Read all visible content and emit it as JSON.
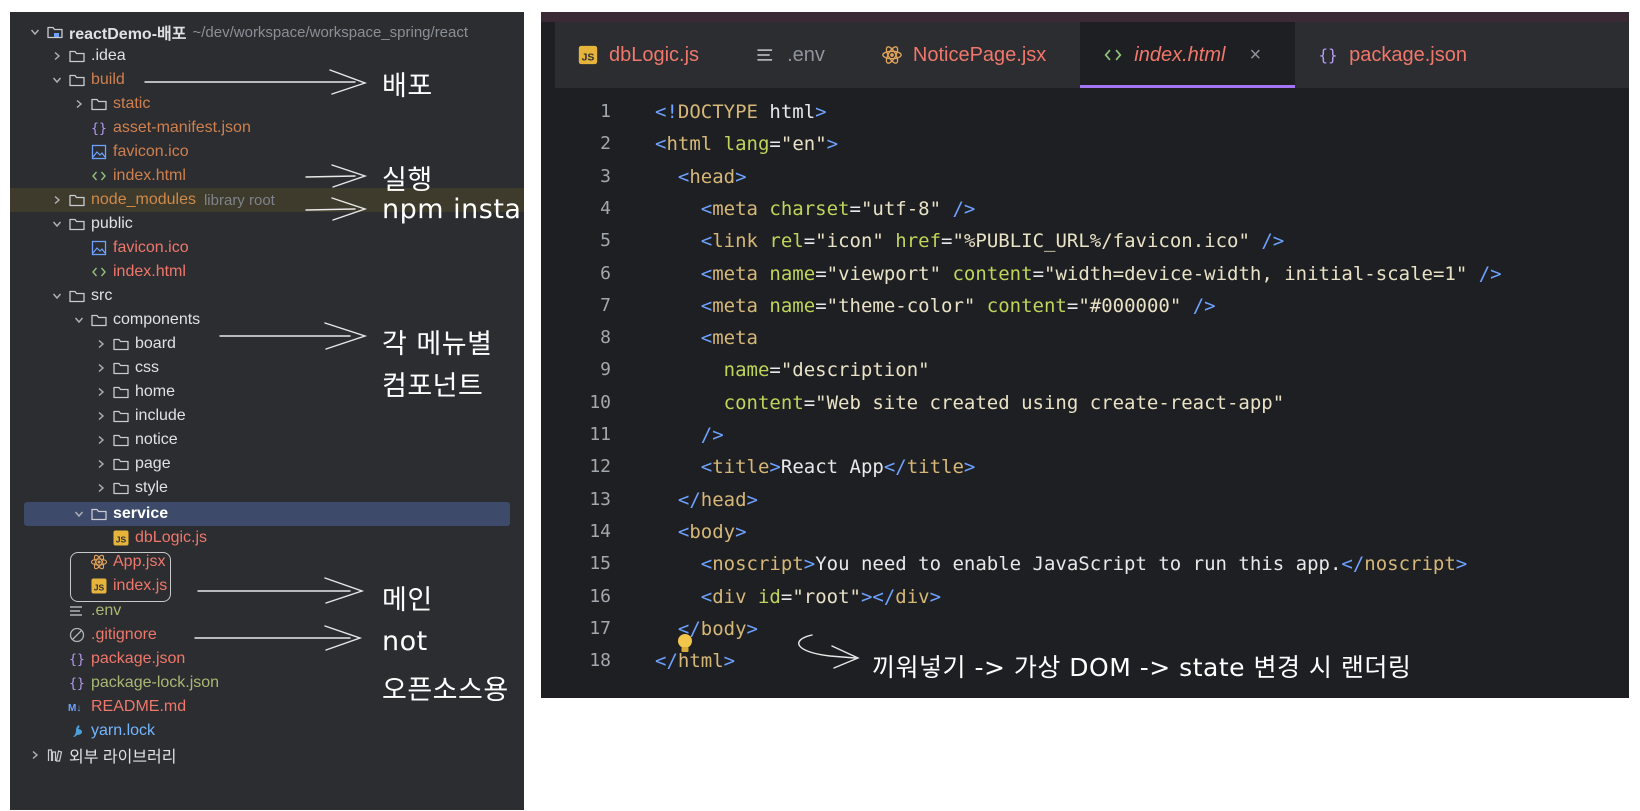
{
  "project_tree": {
    "root": {
      "name": "reactDemo-배포",
      "path": "~/dev/workspace/workspace_spring/react"
    },
    "items": [
      {
        "label": "reactDemo-배포",
        "hint": "~/dev/workspace/workspace_spring/react",
        "icon": "folder-module-icon",
        "expanded": true,
        "color": "default"
      },
      {
        "label": ".idea",
        "icon": "folder-icon",
        "expanded": false,
        "color": "default"
      },
      {
        "label": "build",
        "icon": "folder-icon",
        "expanded": true,
        "color": "excluded"
      },
      {
        "label": "static",
        "icon": "folder-icon",
        "expanded": false,
        "color": "excluded"
      },
      {
        "label": "asset-manifest.json",
        "icon": "json-icon",
        "color": "excluded"
      },
      {
        "label": "favicon.ico",
        "icon": "image-icon",
        "color": "excluded"
      },
      {
        "label": "index.html",
        "icon": "html-icon",
        "color": "excluded"
      },
      {
        "label": "node_modules",
        "hint": "library root",
        "icon": "folder-icon",
        "expanded": false,
        "color": "lib"
      },
      {
        "label": "public",
        "icon": "folder-icon",
        "expanded": true,
        "color": "default"
      },
      {
        "label": "favicon.ico",
        "icon": "image-icon",
        "color": "red"
      },
      {
        "label": "index.html",
        "icon": "html-icon",
        "color": "red"
      },
      {
        "label": "src",
        "icon": "folder-icon",
        "expanded": true,
        "color": "default"
      },
      {
        "label": "components",
        "icon": "folder-icon",
        "expanded": true,
        "color": "default"
      },
      {
        "label": "board",
        "icon": "folder-icon",
        "expanded": false,
        "color": "default"
      },
      {
        "label": "css",
        "icon": "folder-icon",
        "expanded": false,
        "color": "default"
      },
      {
        "label": "home",
        "icon": "folder-icon",
        "expanded": false,
        "color": "default"
      },
      {
        "label": "include",
        "icon": "folder-icon",
        "expanded": false,
        "color": "default"
      },
      {
        "label": "notice",
        "icon": "folder-icon",
        "expanded": false,
        "color": "default"
      },
      {
        "label": "page",
        "icon": "folder-icon",
        "expanded": false,
        "color": "default"
      },
      {
        "label": "style",
        "icon": "folder-icon",
        "expanded": false,
        "color": "default"
      },
      {
        "label": "service",
        "icon": "folder-icon",
        "expanded": true,
        "color": "default",
        "selected": true
      },
      {
        "label": "dbLogic.js",
        "icon": "js-icon",
        "color": "red"
      },
      {
        "label": "App.jsx",
        "icon": "react-icon",
        "color": "red"
      },
      {
        "label": "index.js",
        "icon": "js-icon",
        "color": "red"
      },
      {
        "label": ".env",
        "icon": "env-lines-icon",
        "color": "green"
      },
      {
        "label": ".gitignore",
        "icon": "ignore-icon",
        "color": "red"
      },
      {
        "label": "package.json",
        "icon": "json-icon",
        "color": "red"
      },
      {
        "label": "package-lock.json",
        "icon": "json-icon",
        "color": "green"
      },
      {
        "label": "README.md",
        "icon": "markdown-icon",
        "color": "red"
      },
      {
        "label": "yarn.lock",
        "icon": "yarn-icon",
        "color": "blue"
      },
      {
        "label": "외부 라이브러리",
        "icon": "library-icon",
        "expanded": false,
        "color": "default"
      }
    ]
  },
  "annotations": {
    "build": "배포",
    "index_html": "실행",
    "node_modules": "npm install",
    "components_line1": "각 메뉴별",
    "components_line2": "컴포넌트",
    "main": "메인",
    "env_line1": "not",
    "env_line2": "오픈소스용",
    "root_div": "끼워넣기 -> 가상 DOM -> state 변경 시 랜더링"
  },
  "editor": {
    "tabs": [
      {
        "label": "dbLogic.js",
        "icon": "js-icon",
        "style": "red",
        "active": false
      },
      {
        "label": ".env",
        "icon": "env-lines-icon",
        "style": "gray",
        "active": false
      },
      {
        "label": "NoticePage.jsx",
        "icon": "react-icon",
        "style": "red",
        "active": false
      },
      {
        "label": "index.html",
        "icon": "html-icon",
        "style": "red",
        "active": true,
        "close": "×"
      },
      {
        "label": "package.json",
        "icon": "json-icon",
        "style": "red",
        "active": false
      }
    ],
    "line_numbers": [
      "1",
      "2",
      "3",
      "4",
      "5",
      "6",
      "7",
      "8",
      "9",
      "10",
      "11",
      "12",
      "13",
      "14",
      "15",
      "16",
      "17",
      "18"
    ],
    "code_lines": [
      [
        [
          "br",
          "<!"
        ],
        [
          "kw",
          "DOCTYPE "
        ],
        [
          "txt",
          "html"
        ],
        [
          "br",
          ">"
        ]
      ],
      [
        [
          "br",
          "<"
        ],
        [
          "tag",
          "html "
        ],
        [
          "attr",
          "lang"
        ],
        [
          "txt",
          "="
        ],
        [
          "val",
          "\"en\""
        ],
        [
          "br",
          ">"
        ]
      ],
      [
        [
          "txt",
          "  "
        ],
        [
          "br",
          "<"
        ],
        [
          "tag",
          "head"
        ],
        [
          "br",
          ">"
        ]
      ],
      [
        [
          "txt",
          "    "
        ],
        [
          "br",
          "<"
        ],
        [
          "tag",
          "meta "
        ],
        [
          "attr",
          "charset"
        ],
        [
          "txt",
          "="
        ],
        [
          "val",
          "\"utf-8\""
        ],
        [
          "br",
          " />"
        ]
      ],
      [
        [
          "txt",
          "    "
        ],
        [
          "br",
          "<"
        ],
        [
          "tag",
          "link "
        ],
        [
          "attr",
          "rel"
        ],
        [
          "txt",
          "="
        ],
        [
          "val",
          "\"icon\" "
        ],
        [
          "attr",
          "href"
        ],
        [
          "txt",
          "="
        ],
        [
          "val",
          "\"%PUBLIC_URL%/favicon.ico\""
        ],
        [
          "br",
          " />"
        ]
      ],
      [
        [
          "txt",
          "    "
        ],
        [
          "br",
          "<"
        ],
        [
          "tag",
          "meta "
        ],
        [
          "attr",
          "name"
        ],
        [
          "txt",
          "="
        ],
        [
          "val",
          "\"viewport\" "
        ],
        [
          "attr",
          "content"
        ],
        [
          "txt",
          "="
        ],
        [
          "val",
          "\"width=device-width, initial-scale=1\""
        ],
        [
          "br",
          " />"
        ]
      ],
      [
        [
          "txt",
          "    "
        ],
        [
          "br",
          "<"
        ],
        [
          "tag",
          "meta "
        ],
        [
          "attr",
          "name"
        ],
        [
          "txt",
          "="
        ],
        [
          "val",
          "\"theme-color\" "
        ],
        [
          "attr",
          "content"
        ],
        [
          "txt",
          "="
        ],
        [
          "val",
          "\"#000000\""
        ],
        [
          "br",
          " />"
        ]
      ],
      [
        [
          "txt",
          "    "
        ],
        [
          "br",
          "<"
        ],
        [
          "tag",
          "meta"
        ]
      ],
      [
        [
          "txt",
          "      "
        ],
        [
          "attr",
          "name"
        ],
        [
          "txt",
          "="
        ],
        [
          "val",
          "\"description\""
        ]
      ],
      [
        [
          "txt",
          "      "
        ],
        [
          "attr",
          "content"
        ],
        [
          "txt",
          "="
        ],
        [
          "val",
          "\"Web site created using create-react-app\""
        ]
      ],
      [
        [
          "txt",
          "    "
        ],
        [
          "br",
          "/>"
        ]
      ],
      [
        [
          "txt",
          "    "
        ],
        [
          "br",
          "<"
        ],
        [
          "tag",
          "title"
        ],
        [
          "br",
          ">"
        ],
        [
          "txt",
          "React App"
        ],
        [
          "br",
          "</"
        ],
        [
          "tag",
          "title"
        ],
        [
          "br",
          ">"
        ]
      ],
      [
        [
          "txt",
          "  "
        ],
        [
          "br",
          "</"
        ],
        [
          "tag",
          "head"
        ],
        [
          "br",
          ">"
        ]
      ],
      [
        [
          "txt",
          "  "
        ],
        [
          "br",
          "<"
        ],
        [
          "tag",
          "body"
        ],
        [
          "br",
          ">"
        ]
      ],
      [
        [
          "txt",
          "    "
        ],
        [
          "br",
          "<"
        ],
        [
          "tag",
          "noscript"
        ],
        [
          "br",
          ">"
        ],
        [
          "txt",
          "You need to enable JavaScript to run this app."
        ],
        [
          "br",
          "</"
        ],
        [
          "tag",
          "noscript"
        ],
        [
          "br",
          ">"
        ]
      ],
      [
        [
          "txt",
          "    "
        ],
        [
          "br",
          "<"
        ],
        [
          "tag",
          "div "
        ],
        [
          "attr",
          "id"
        ],
        [
          "txt",
          "="
        ],
        [
          "val",
          "\"root\""
        ],
        [
          "br",
          "></"
        ],
        [
          "tag",
          "div"
        ],
        [
          "br",
          ">"
        ]
      ],
      [
        [
          "txt",
          "  "
        ],
        [
          "br",
          "</"
        ],
        [
          "tag",
          "body"
        ],
        [
          "br",
          ">"
        ]
      ],
      [
        [
          "br",
          "</"
        ],
        [
          "tag",
          "html"
        ],
        [
          "br",
          ">"
        ]
      ]
    ]
  },
  "colors": {
    "panel_bg": "#2b2d30",
    "editor_bg": "#1e1f22",
    "selection": "#3d4a6a",
    "active_tab_underline": "#a375f2",
    "red_file": "#f0776b",
    "green_file": "#a9b873",
    "excluded": "#d0804f"
  }
}
